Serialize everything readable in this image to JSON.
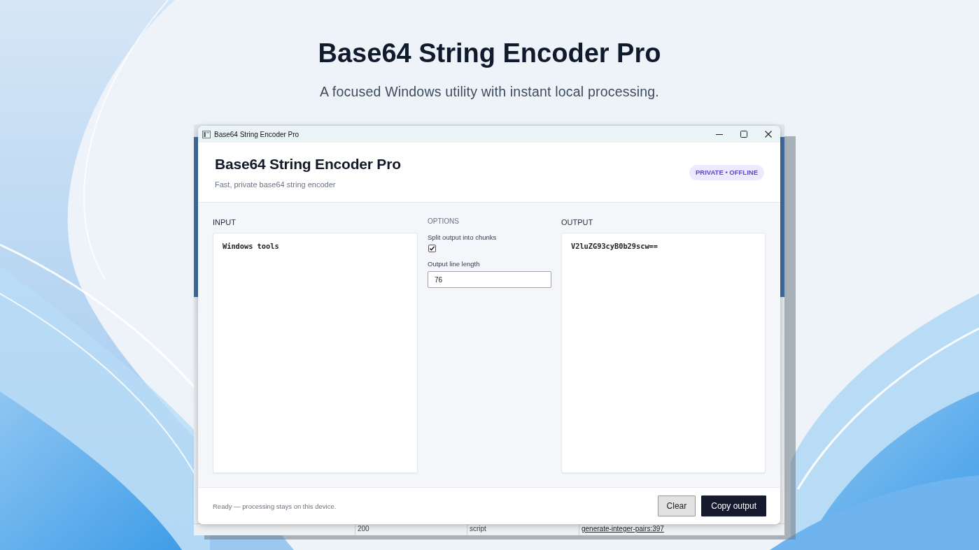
{
  "page": {
    "title": "Base64 String Encoder Pro",
    "subtitle": "A focused Windows utility with instant local processing."
  },
  "background_window": {
    "row": [
      "200",
      "script",
      "generate-integer-pairs:397"
    ]
  },
  "window": {
    "title": "Base64 String Encoder Pro"
  },
  "header": {
    "title": "Base64 String Encoder Pro",
    "subtitle": "Fast, private base64 string encoder",
    "badge": "PRIVATE • OFFLINE"
  },
  "input": {
    "label": "INPUT",
    "value": "Windows tools"
  },
  "options": {
    "label": "OPTIONS",
    "items": [
      {
        "kind": "checkbox",
        "label": "Split output into chunks",
        "checked": true
      },
      {
        "kind": "number",
        "label": "Output line length",
        "value": "76"
      }
    ]
  },
  "output": {
    "label": "OUTPUT",
    "value": "V2luZG93cyB0b29scw=="
  },
  "status_bar": {
    "text": "Ready — processing stays on this device.",
    "buttons": [
      {
        "label": "Clear",
        "kind": "secondary"
      },
      {
        "label": "Copy output",
        "kind": "primary"
      }
    ]
  }
}
